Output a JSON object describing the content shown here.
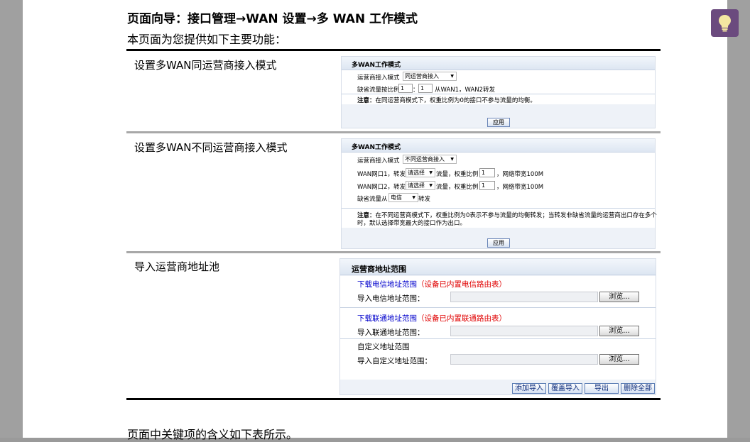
{
  "doc": {
    "heading": "页面向导：接口管理→WAN 设置→多 WAN 工作模式",
    "intro": "本页面为您提供如下主要功能：",
    "footer": "页面中关键项的含义如下表所示。"
  },
  "rows": [
    {
      "label": "设置多WAN同运营商接入模式"
    },
    {
      "label": "设置多WAN不同运营商接入模式"
    },
    {
      "label": "导入运营商地址池"
    }
  ],
  "panel1": {
    "title": "多WAN工作模式",
    "mode_label": "运营商接入模式",
    "mode_value": "同运营商接入",
    "ratio_label": "缺省流量按比例",
    "ratio_a": "1",
    "ratio_colon": "：",
    "ratio_b": "1",
    "ratio_suffix": "从WAN1，WAN2转发",
    "note_bold": "注意：",
    "note": "在同运营商模式下，权重比例为0的接口不参与流量的均衡。",
    "apply": "应用"
  },
  "panel2": {
    "title": "多WAN工作模式",
    "mode_label": "运营商接入模式",
    "mode_value": "不同运营商接入",
    "wan1_label": "WAN网口1，转发",
    "wan1_select": "请选择",
    "wan1_mid": "流量，权重比例",
    "wan1_weight": "1",
    "wan1_suffix": "，网络带宽100M",
    "wan2_label": "WAN网口2，转发",
    "wan2_select": "请选择",
    "wan2_mid": "流量，权重比例",
    "wan2_weight": "1",
    "wan2_suffix": "，网络带宽100M",
    "default_label": "缺省流量从",
    "default_value": "电信",
    "default_suffix": "转发",
    "note_bold": "注意：",
    "note_line1": "在不同运营商模式下，权重比例为0表示不参与流量的均衡转发；当转发非缺省流量的运营商出口存在多个",
    "note_line2": "时，默认选择带宽最大的接口作为出口。",
    "apply": "应用"
  },
  "panel3": {
    "title": "运营商地址范围",
    "telecom_link": "下载电信地址范围",
    "telecom_note": "（设备已内置电信路由表）",
    "telecom_import": "导入电信地址范围：",
    "unicom_link": "下载联通地址范围",
    "unicom_note": "（设备已内置联通路由表）",
    "unicom_import": "导入联通地址范围：",
    "custom_title": "自定义地址范围",
    "custom_import": "导入自定义地址范围：",
    "browse": "浏览...",
    "btn_add": "添加导入",
    "btn_overwrite": "覆盖导入",
    "btn_export": "导出",
    "btn_delete": "删除全部"
  },
  "icons": {
    "assistant": "lightbulb-icon",
    "accent": "#6b4a7e"
  }
}
